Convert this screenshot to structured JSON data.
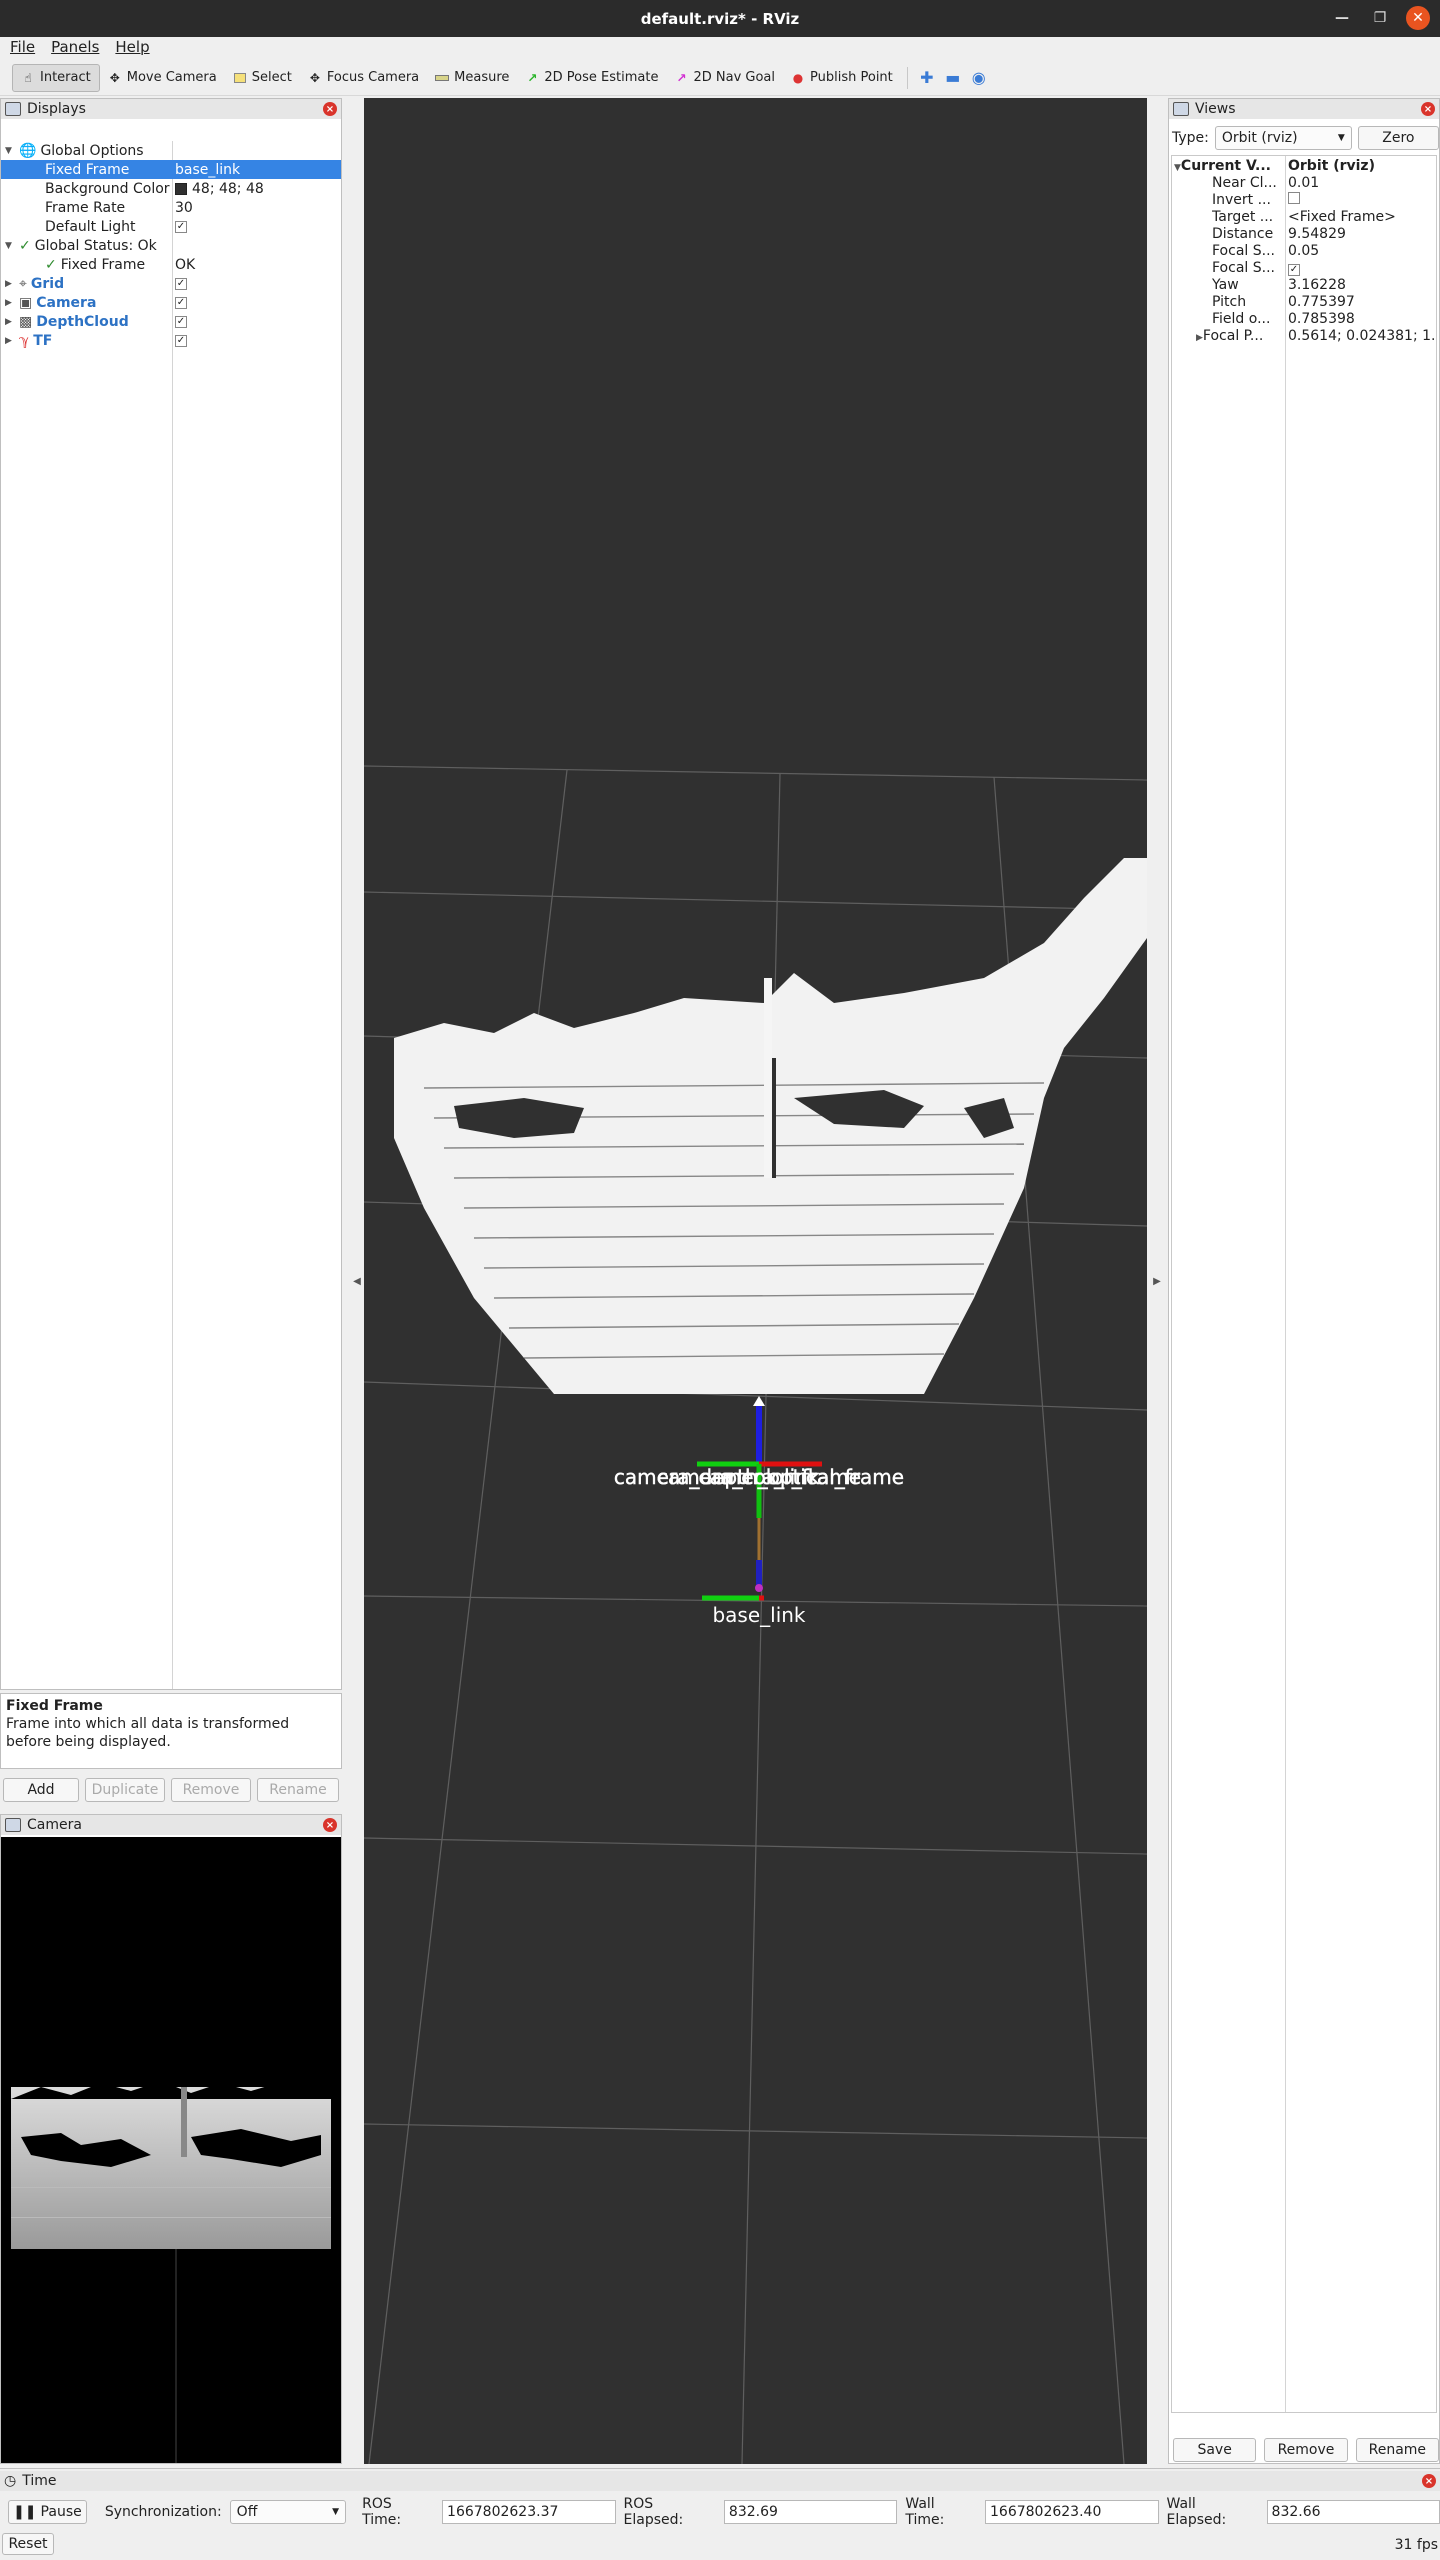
{
  "window": {
    "title": "default.rviz* - RViz"
  },
  "menu": [
    "File",
    "Panels",
    "Help"
  ],
  "toolbar": {
    "tools": [
      {
        "label": "Interact",
        "icon": "hand-icon",
        "active": true
      },
      {
        "label": "Move Camera",
        "icon": "move-camera-icon"
      },
      {
        "label": "Select",
        "icon": "select-icon"
      },
      {
        "label": "Focus Camera",
        "icon": "focus-camera-icon"
      },
      {
        "label": "Measure",
        "icon": "ruler-icon"
      },
      {
        "label": "2D Pose Estimate",
        "icon": "green-arrow-icon"
      },
      {
        "label": "2D Nav Goal",
        "icon": "magenta-arrow-icon"
      },
      {
        "label": "Publish Point",
        "icon": "map-pin-icon"
      }
    ]
  },
  "displays": {
    "title": "Displays",
    "rows": [
      {
        "key": "Global Options"
      },
      {
        "key": "Fixed Frame",
        "value": "base_link"
      },
      {
        "key": "Background Color",
        "value": "48; 48; 48"
      },
      {
        "key": "Frame Rate",
        "value": "30"
      },
      {
        "key": "Default Light"
      },
      {
        "key": "Global Status: Ok"
      },
      {
        "key": "Fixed Frame",
        "value": "OK"
      },
      {
        "key": "Grid"
      },
      {
        "key": "Camera"
      },
      {
        "key": "DepthCloud"
      },
      {
        "key": "TF"
      }
    ],
    "description": {
      "title": "Fixed Frame",
      "text": "Frame into which all data is transformed before being displayed."
    },
    "buttons": [
      "Add",
      "Duplicate",
      "Remove",
      "Rename"
    ]
  },
  "camera_panel": {
    "title": "Camera"
  },
  "viewport": {
    "background": "#303030",
    "frame_labels": [
      "camera_depth_optical_frame",
      "camera_link",
      "camera_color_frame",
      "base_link"
    ]
  },
  "views": {
    "title": "Views",
    "type_label": "Type:",
    "type_value": "Orbit (rviz)",
    "zero_label": "Zero",
    "rows": [
      {
        "key": "Current V...",
        "value": "Orbit (rviz)"
      },
      {
        "key": "Near Cl...",
        "value": "0.01"
      },
      {
        "key": "Invert ...",
        "value": ""
      },
      {
        "key": "Target ...",
        "value": "<Fixed Frame>"
      },
      {
        "key": "Distance",
        "value": "9.54829"
      },
      {
        "key": "Focal S...",
        "value": "0.05"
      },
      {
        "key": "Focal S...",
        "value": ""
      },
      {
        "key": "Yaw",
        "value": "3.16228"
      },
      {
        "key": "Pitch",
        "value": "0.775397"
      },
      {
        "key": "Field o...",
        "value": "0.785398"
      },
      {
        "key": "Focal P...",
        "value": "0.5614; 0.024381; 1...."
      }
    ],
    "buttons": [
      "Save",
      "Remove",
      "Rename"
    ]
  },
  "time": {
    "title": "Time",
    "pause_label": "Pause",
    "sync_label": "Synchronization:",
    "sync_value": "Off",
    "ros_time_label": "ROS Time:",
    "ros_time": "1667802623.37",
    "ros_elapsed_label": "ROS Elapsed:",
    "ros_elapsed": "832.69",
    "wall_time_label": "Wall Time:",
    "wall_time": "1667802623.40",
    "wall_elapsed_label": "Wall Elapsed:",
    "wall_elapsed": "832.66",
    "reset_label": "Reset",
    "fps": "31 fps"
  }
}
